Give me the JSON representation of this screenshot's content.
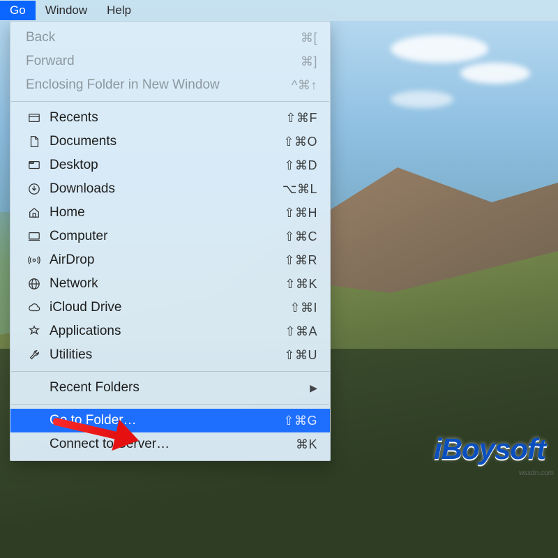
{
  "menubar": {
    "items": [
      {
        "label": "Go",
        "active": true
      },
      {
        "label": "Window",
        "active": false
      },
      {
        "label": "Help",
        "active": false
      }
    ]
  },
  "menu": {
    "section1": [
      {
        "icon": "",
        "label": "Back",
        "shortcut": "⌘[",
        "disabled": true
      },
      {
        "icon": "",
        "label": "Forward",
        "shortcut": "⌘]",
        "disabled": true
      },
      {
        "icon": "",
        "label": "Enclosing Folder in New Window",
        "shortcut": "^⌘↑",
        "disabled": true
      }
    ],
    "section2": [
      {
        "icon": "recents-icon",
        "label": "Recents",
        "shortcut": "⇧⌘F"
      },
      {
        "icon": "documents-icon",
        "label": "Documents",
        "shortcut": "⇧⌘O"
      },
      {
        "icon": "desktop-icon",
        "label": "Desktop",
        "shortcut": "⇧⌘D"
      },
      {
        "icon": "downloads-icon",
        "label": "Downloads",
        "shortcut": "⌥⌘L"
      },
      {
        "icon": "home-icon",
        "label": "Home",
        "shortcut": "⇧⌘H"
      },
      {
        "icon": "computer-icon",
        "label": "Computer",
        "shortcut": "⇧⌘C"
      },
      {
        "icon": "airdrop-icon",
        "label": "AirDrop",
        "shortcut": "⇧⌘R"
      },
      {
        "icon": "network-icon",
        "label": "Network",
        "shortcut": "⇧⌘K"
      },
      {
        "icon": "icloud-icon",
        "label": "iCloud Drive",
        "shortcut": "⇧⌘I"
      },
      {
        "icon": "applications-icon",
        "label": "Applications",
        "shortcut": "⇧⌘A"
      },
      {
        "icon": "utilities-icon",
        "label": "Utilities",
        "shortcut": "⇧⌘U"
      }
    ],
    "section3": [
      {
        "icon": "",
        "label": "Recent Folders",
        "submenu": true
      }
    ],
    "section4": [
      {
        "icon": "",
        "label": "Go to Folder…",
        "shortcut": "⇧⌘G",
        "highlight": true
      },
      {
        "icon": "",
        "label": "Connect to Server…",
        "shortcut": "⌘K"
      }
    ]
  },
  "watermark": {
    "text": "iBoysoft",
    "small": "wsxdn.com"
  }
}
